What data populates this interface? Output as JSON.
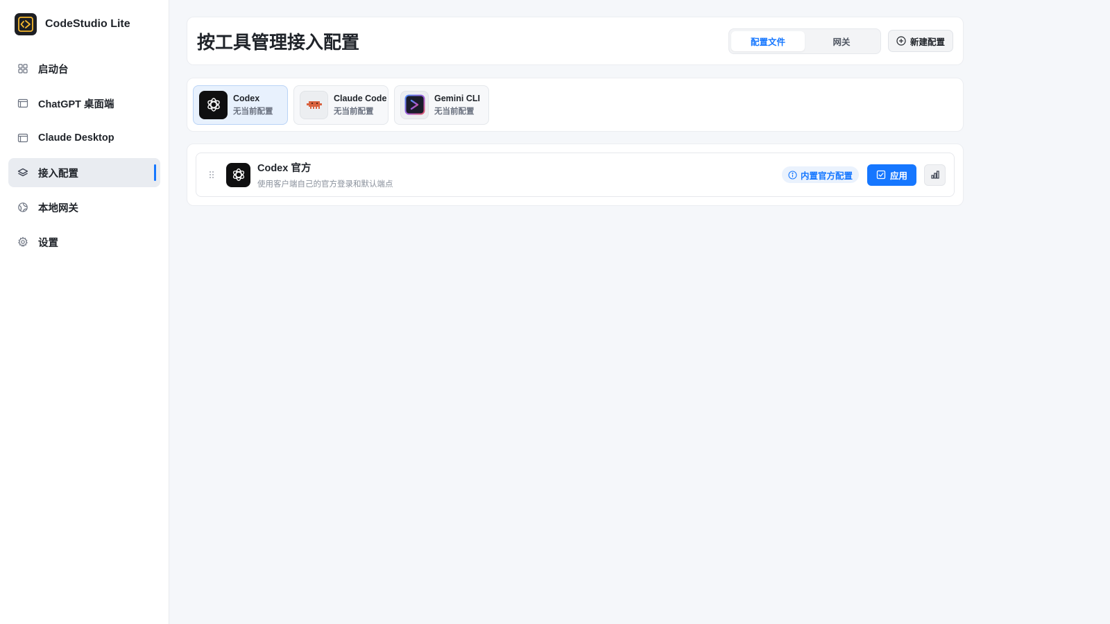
{
  "app": {
    "name": "CodeStudio Lite"
  },
  "sidebar": {
    "items": [
      {
        "label": "启动台",
        "icon": "grid-icon"
      },
      {
        "label": "ChatGPT 桌面端",
        "icon": "window-icon"
      },
      {
        "label": "Claude Desktop",
        "icon": "window-icon"
      },
      {
        "label": "接入配置",
        "icon": "layers-icon",
        "active": true
      },
      {
        "label": "本地网关",
        "icon": "globe-icon"
      },
      {
        "label": "设置",
        "icon": "gear-icon"
      }
    ]
  },
  "header": {
    "title": "按工具管理接入配置",
    "tabs": [
      {
        "label": "配置文件",
        "active": true
      },
      {
        "label": "网关",
        "active": false
      }
    ],
    "new_button": "新建配置"
  },
  "tools": [
    {
      "name": "Codex",
      "status": "无当前配置",
      "active": true,
      "icon": "openai-icon"
    },
    {
      "name": "Claude Code",
      "status": "无当前配置",
      "active": false,
      "icon": "claude-code-icon"
    },
    {
      "name": "Gemini CLI",
      "status": "无当前配置",
      "active": false,
      "icon": "gemini-cli-icon"
    }
  ],
  "profiles": [
    {
      "name": "Codex 官方",
      "description": "使用客户端自己的官方登录和默认端点",
      "badge": "内置官方配置",
      "apply_label": "应用"
    }
  ],
  "colors": {
    "accent": "#1677ff",
    "active_nav_bg": "#e9ecf1",
    "active_tool_bg": "#e8f1fd",
    "claude_orange": "#d9623f"
  }
}
